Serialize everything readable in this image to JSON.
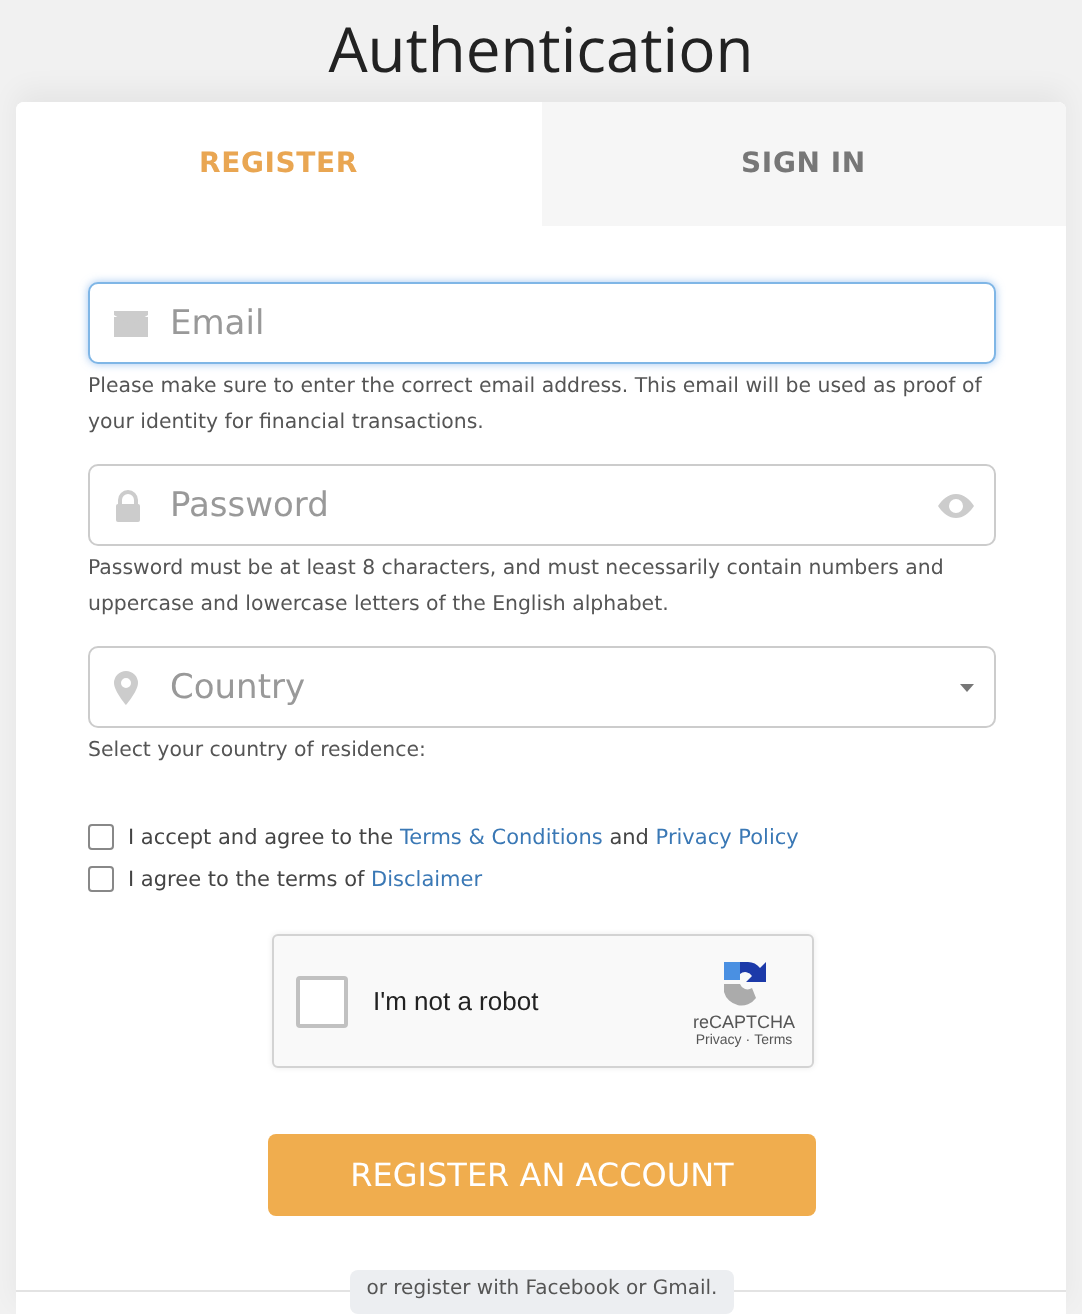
{
  "title": "Authentication",
  "tabs": [
    {
      "label": "REGISTER",
      "selected": true
    },
    {
      "label": "SIGN IN",
      "selected": false
    }
  ],
  "fields": [
    {
      "kind": "email",
      "placeholder": "Email",
      "focused": true,
      "hint": "Please make sure to enter the correct email address. This email will be used as proof of your identity for financial transactions."
    },
    {
      "kind": "password",
      "placeholder": "Password",
      "focused": false,
      "hint": "Password must be at least 8 characters, and must necessarily contain numbers and uppercase and lowercase letters of the English alphabet."
    },
    {
      "kind": "select",
      "placeholder": "Country",
      "focused": false,
      "hint": "Select your country of residence:"
    }
  ],
  "agreements": [
    {
      "checked": false,
      "parts": [
        {
          "kind": "text",
          "text": "I accept and agree to the "
        },
        {
          "kind": "link",
          "text": "Terms & Conditions"
        },
        {
          "kind": "text",
          "text": " and "
        },
        {
          "kind": "link",
          "text": "Privacy Policy"
        }
      ]
    },
    {
      "checked": false,
      "parts": [
        {
          "kind": "text",
          "text": "I agree to the terms of "
        },
        {
          "kind": "link",
          "text": "Disclaimer"
        }
      ]
    }
  ],
  "captcha": {
    "checked": false,
    "label": "I'm not a robot",
    "brand": "reCAPTCHA",
    "links": [
      "Privacy",
      "Terms"
    ],
    "separator": "·"
  },
  "submit": "REGISTER AN ACCOUNT",
  "social_note": "or register with Facebook or Gmail."
}
